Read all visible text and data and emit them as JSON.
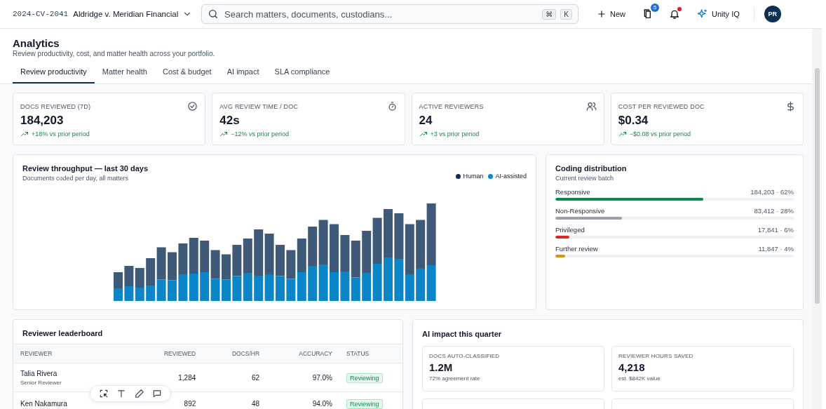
{
  "header": {
    "matter_id": "2024-CV-2041",
    "matter_name": "Aldridge v. Meridian Financial",
    "search": {
      "placeholder": "Search matters, documents, custodians...",
      "keys": [
        "⌘",
        "K"
      ]
    },
    "new_label": "New",
    "notification_count": "5",
    "alerts_unread": true,
    "assistant_label": "Unity IQ",
    "avatar": "PR"
  },
  "page": {
    "title": "Analytics",
    "subtitle": "Review productivity, cost, and matter health across your portfolio."
  },
  "tabs": [
    {
      "label": "Review productivity",
      "selected": true
    },
    {
      "label": "Matter health",
      "selected": false
    },
    {
      "label": "Cost & budget",
      "selected": false
    },
    {
      "label": "AI impact",
      "selected": false
    },
    {
      "label": "SLA compliance",
      "selected": false
    }
  ],
  "kpis": [
    {
      "label": "DOCS REVIEWED (7D)",
      "value": "184,203",
      "delta": "+18% vs prior period"
    },
    {
      "label": "AVG REVIEW TIME / DOC",
      "value": "42s",
      "delta": "−12% vs prior period"
    },
    {
      "label": "ACTIVE REVIEWERS",
      "value": "24",
      "delta": "+3 vs prior period"
    },
    {
      "label": "COST PER REVIEWED DOC",
      "value": "$0.34",
      "delta": "−$0.08 vs prior period"
    }
  ],
  "throughput": {
    "title": "Review throughput — last 30 days",
    "subtitle": "Documents coded per day, all matters",
    "legend": [
      {
        "label": "Human",
        "color": "#0f2f57"
      },
      {
        "label": "AI-assisted",
        "color": "#0a85c8"
      }
    ]
  },
  "coding": {
    "title": "Coding distribution",
    "subtitle": "Current review batch",
    "rows": [
      {
        "label": "Responsive",
        "reading": "184,203 · 62%",
        "level": 0.62,
        "color": "#0a8a46"
      },
      {
        "label": "Non-Responsive",
        "reading": "83,412 · 28%",
        "level": 0.28,
        "color": "#9aa0a8"
      },
      {
        "label": "Privileged",
        "reading": "17,841 · 6%",
        "level": 0.06,
        "color": "#dc2626"
      },
      {
        "label": "Further review",
        "reading": "11,847 · 4%",
        "level": 0.04,
        "color": "#d99400"
      }
    ]
  },
  "leaderboard": {
    "title": "Reviewer leaderboard",
    "columns": [
      "REVIEWER",
      "REVIEWED",
      "DOCS/HR",
      "ACCURACY",
      "STATUS"
    ],
    "rows": [
      {
        "name": "Talia Rivera",
        "role": "Senior Reviewer",
        "reviewed": "1,284",
        "docs_hr": "62",
        "accuracy": "97.0%",
        "status": "Reviewing"
      },
      {
        "name": "Ken Nakamura",
        "reviewed": "892",
        "docs_hr": "48",
        "accuracy": "94.0%",
        "status": "Reviewing"
      }
    ]
  },
  "ai_impact": {
    "title": "AI impact this quarter",
    "tiles": [
      {
        "label": "DOCS AUTO-CLASSIFIED",
        "value": "1.2M",
        "note": "72% agreement rate"
      },
      {
        "label": "REVIEWER HOURS SAVED",
        "value": "4,218",
        "note": "est. $842K value"
      }
    ]
  }
}
